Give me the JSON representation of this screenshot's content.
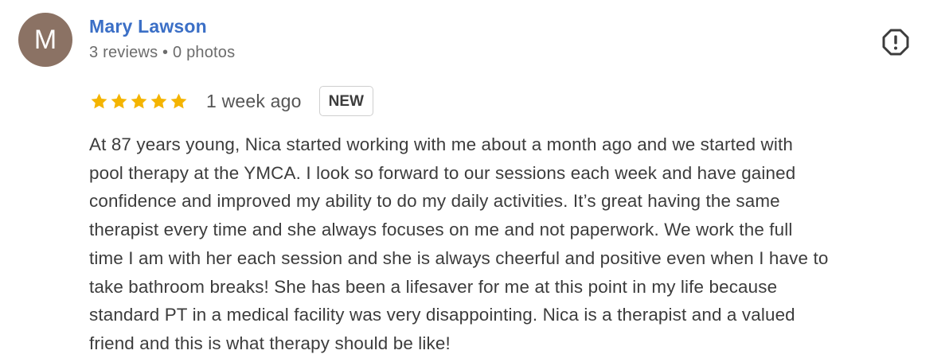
{
  "reviewer": {
    "avatar_letter": "M",
    "avatar_color": "#8b7264",
    "name": "Mary Lawson",
    "stats": "3 reviews • 0 photos"
  },
  "review": {
    "rating": 5,
    "rating_max": 5,
    "star_color": "#f4b400",
    "time_ago": "1 week ago",
    "badge": "NEW",
    "text_lines": [
      "At 87 years young, Nica started working with me about a month ago and we started with",
      "pool therapy at the YMCA. I look so forward to our sessions each week and have gained",
      "confidence and improved my ability to do my daily activities. It’s great having the same",
      "therapist every time and she always focuses on me and not paperwork. We work the full",
      "time I am with her each session and she is always cheerful and positive even when I have to",
      "take bathroom breaks! She has been a lifesaver for me at this point in my life because",
      "standard PT in a medical facility was very disappointing. Nica is a therapist and a valued",
      "friend and this is what therapy should be like!"
    ]
  },
  "actions": {
    "report_icon": "report-octagon-icon"
  },
  "colors": {
    "name_link": "#3b6fc6",
    "text": "#3c3c3c",
    "muted": "#6c6c6c"
  }
}
